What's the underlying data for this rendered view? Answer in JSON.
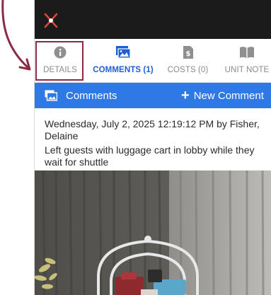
{
  "topbar": {
    "close_icon": "close-x-icon"
  },
  "tabs": [
    {
      "label": "DETAILS",
      "icon": "info-circle-icon",
      "active": false
    },
    {
      "label": "COMMENTS (1)",
      "icon": "image-icon",
      "active": true
    },
    {
      "label": "COSTS (0)",
      "icon": "dollar-document-icon",
      "active": false
    },
    {
      "label": "UNIT NOTE",
      "icon": "book-icon",
      "active": false
    }
  ],
  "comments_bar": {
    "title": "Comments",
    "new_label": "New Comment"
  },
  "comment": {
    "meta": "Wednesday, July 2, 2025 12:19:12 PM by Fisher, Delaine",
    "body": "Left guests with luggage cart in lobby while they wait for shuttle"
  },
  "colors": {
    "topbar": "#1b1b1b",
    "accent_blue": "#2f79e6",
    "active_tab": "#1f5fd1",
    "annotation": "#8a2a45",
    "close_x": "#e0423c"
  }
}
